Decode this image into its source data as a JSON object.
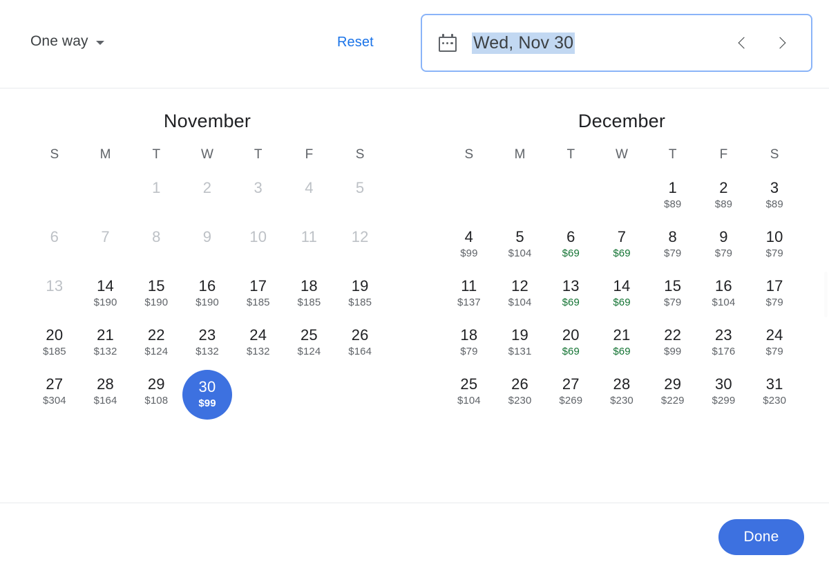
{
  "toolbar": {
    "trip_type_label": "One way",
    "trip_type_icon": "chevron-down-icon",
    "reset_label": "Reset"
  },
  "date_field": {
    "icon": "calendar-icon",
    "value": "Wed, Nov 30",
    "prev_icon": "chevron-left-icon",
    "next_icon": "chevron-right-icon"
  },
  "colors": {
    "accent_blue": "#3d71e0",
    "link_blue": "#1a73e8",
    "focus_border": "#8ab4f8",
    "selection_highlight": "#c2d8f2",
    "cheap_price_green": "#137333",
    "disabled_gray": "#bdc1c6"
  },
  "calendar": {
    "day_headers": [
      "S",
      "M",
      "T",
      "W",
      "T",
      "F",
      "S"
    ],
    "selected_date": "Nov 30",
    "months": [
      {
        "title": "November",
        "leading_blanks": 2,
        "days": [
          {
            "day": "1",
            "price": "",
            "disabled": true
          },
          {
            "day": "2",
            "price": "",
            "disabled": true
          },
          {
            "day": "3",
            "price": "",
            "disabled": true
          },
          {
            "day": "4",
            "price": "",
            "disabled": true
          },
          {
            "day": "5",
            "price": "",
            "disabled": true
          },
          {
            "day": "6",
            "price": "",
            "disabled": true
          },
          {
            "day": "7",
            "price": "",
            "disabled": true
          },
          {
            "day": "8",
            "price": "",
            "disabled": true
          },
          {
            "day": "9",
            "price": "",
            "disabled": true
          },
          {
            "day": "10",
            "price": "",
            "disabled": true
          },
          {
            "day": "11",
            "price": "",
            "disabled": true
          },
          {
            "day": "12",
            "price": "",
            "disabled": true
          },
          {
            "day": "13",
            "price": "",
            "disabled": true
          },
          {
            "day": "14",
            "price": "$190",
            "cheap": false
          },
          {
            "day": "15",
            "price": "$190",
            "cheap": false
          },
          {
            "day": "16",
            "price": "$190",
            "cheap": false
          },
          {
            "day": "17",
            "price": "$185",
            "cheap": false
          },
          {
            "day": "18",
            "price": "$185",
            "cheap": false
          },
          {
            "day": "19",
            "price": "$185",
            "cheap": false
          },
          {
            "day": "20",
            "price": "$185",
            "cheap": false
          },
          {
            "day": "21",
            "price": "$132",
            "cheap": false
          },
          {
            "day": "22",
            "price": "$124",
            "cheap": false
          },
          {
            "day": "23",
            "price": "$132",
            "cheap": false
          },
          {
            "day": "24",
            "price": "$132",
            "cheap": false
          },
          {
            "day": "25",
            "price": "$124",
            "cheap": false
          },
          {
            "day": "26",
            "price": "$164",
            "cheap": false
          },
          {
            "day": "27",
            "price": "$304",
            "cheap": false
          },
          {
            "day": "28",
            "price": "$164",
            "cheap": false
          },
          {
            "day": "29",
            "price": "$108",
            "cheap": false
          },
          {
            "day": "30",
            "price": "$99",
            "cheap": false,
            "selected": true
          }
        ]
      },
      {
        "title": "December",
        "leading_blanks": 4,
        "days": [
          {
            "day": "1",
            "price": "$89",
            "cheap": false
          },
          {
            "day": "2",
            "price": "$89",
            "cheap": false
          },
          {
            "day": "3",
            "price": "$89",
            "cheap": false
          },
          {
            "day": "4",
            "price": "$99",
            "cheap": false
          },
          {
            "day": "5",
            "price": "$104",
            "cheap": false
          },
          {
            "day": "6",
            "price": "$69",
            "cheap": true
          },
          {
            "day": "7",
            "price": "$69",
            "cheap": true
          },
          {
            "day": "8",
            "price": "$79",
            "cheap": false
          },
          {
            "day": "9",
            "price": "$79",
            "cheap": false
          },
          {
            "day": "10",
            "price": "$79",
            "cheap": false
          },
          {
            "day": "11",
            "price": "$137",
            "cheap": false
          },
          {
            "day": "12",
            "price": "$104",
            "cheap": false
          },
          {
            "day": "13",
            "price": "$69",
            "cheap": true
          },
          {
            "day": "14",
            "price": "$69",
            "cheap": true
          },
          {
            "day": "15",
            "price": "$79",
            "cheap": false
          },
          {
            "day": "16",
            "price": "$104",
            "cheap": false
          },
          {
            "day": "17",
            "price": "$79",
            "cheap": false
          },
          {
            "day": "18",
            "price": "$79",
            "cheap": false
          },
          {
            "day": "19",
            "price": "$131",
            "cheap": false
          },
          {
            "day": "20",
            "price": "$69",
            "cheap": true
          },
          {
            "day": "21",
            "price": "$69",
            "cheap": true
          },
          {
            "day": "22",
            "price": "$99",
            "cheap": false
          },
          {
            "day": "23",
            "price": "$176",
            "cheap": false
          },
          {
            "day": "24",
            "price": "$79",
            "cheap": false
          },
          {
            "day": "25",
            "price": "$104",
            "cheap": false
          },
          {
            "day": "26",
            "price": "$230",
            "cheap": false
          },
          {
            "day": "27",
            "price": "$269",
            "cheap": false
          },
          {
            "day": "28",
            "price": "$230",
            "cheap": false
          },
          {
            "day": "29",
            "price": "$229",
            "cheap": false
          },
          {
            "day": "30",
            "price": "$299",
            "cheap": false
          },
          {
            "day": "31",
            "price": "$230",
            "cheap": false
          }
        ]
      }
    ]
  },
  "footer": {
    "done_label": "Done"
  }
}
